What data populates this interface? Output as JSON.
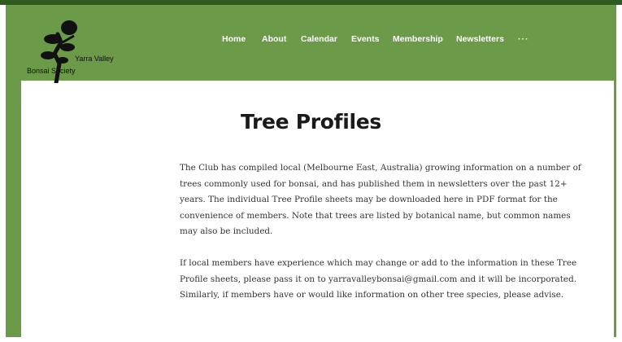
{
  "site": {
    "logo_line1": "Yarra Valley",
    "logo_line2": "Bonsai Society"
  },
  "nav": {
    "items": [
      "Home",
      "About",
      "Calendar",
      "Events",
      "Membership",
      "Newsletters",
      "···"
    ]
  },
  "main": {
    "title": "Tree Profiles",
    "paragraph1": "The Club has compiled local (Melbourne East, Australia) growing information on a number of trees commonly used for bonsai, and has published them in newsletters over the past 12+ years. The individual Tree Profile sheets may be downloaded here in PDF format for the convenience of members. Note that trees are listed by botanical name, but common names may also be included.",
    "paragraph2": "If local members have experience which may change or add to the information in these Tree Profile sheets, please pass it on to yarravalleybonsai@gmail.com and it will be incorporated. Similarly, if members have or would like information on other tree species, please advise."
  },
  "colors": {
    "header_green": "#6b9a48",
    "top_strip": "#2c5a1f",
    "page_background": "#ffffff"
  }
}
